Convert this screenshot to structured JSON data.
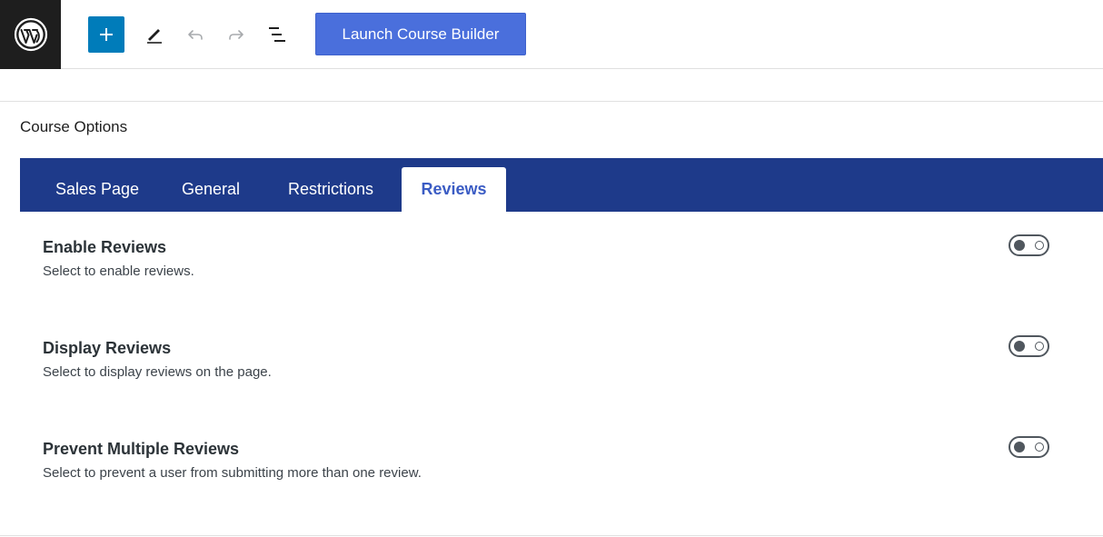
{
  "toolbar": {
    "logo_icon": "wordpress-icon",
    "add_icon": "plus-icon",
    "edit_icon": "pencil-icon",
    "undo_icon": "undo-icon",
    "redo_icon": "redo-icon",
    "list_view_icon": "list-view-icon",
    "launch_label": "Launch Course Builder"
  },
  "section": {
    "title": "Course Options"
  },
  "tabs": [
    {
      "label": "Sales Page",
      "active": false
    },
    {
      "label": "General",
      "active": false
    },
    {
      "label": "Restrictions",
      "active": false
    },
    {
      "label": "Reviews",
      "active": true
    }
  ],
  "settings": [
    {
      "title": "Enable Reviews",
      "description": "Select to enable reviews.",
      "enabled": false
    },
    {
      "title": "Display Reviews",
      "description": "Select to display reviews on the page.",
      "enabled": false
    },
    {
      "title": "Prevent Multiple Reviews",
      "description": "Select to prevent a user from submitting more than one review.",
      "enabled": false
    }
  ],
  "colors": {
    "tabbar": "#1e3a8a",
    "active_tab_text": "#3b5cc4",
    "add_button": "#007cba",
    "launch_button": "#4a6fdc"
  }
}
